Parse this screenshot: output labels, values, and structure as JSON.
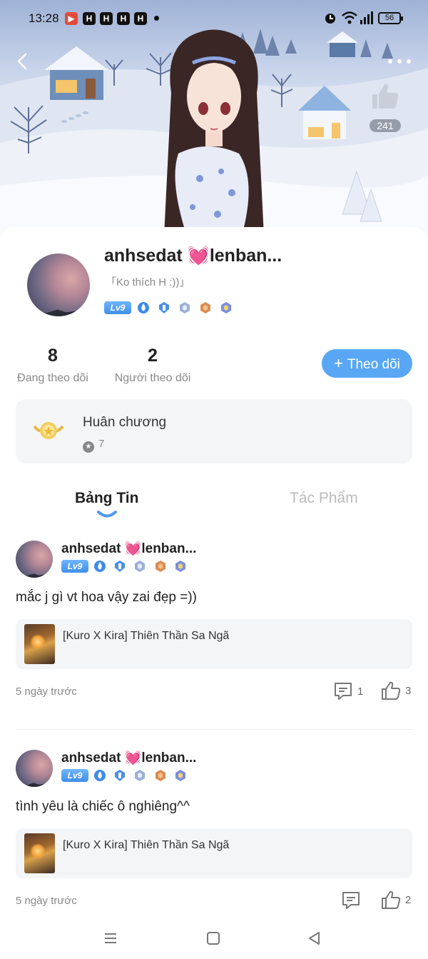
{
  "status_bar": {
    "time": "13:28",
    "battery": "56",
    "app_icons": [
      "game-app-icon",
      "h-app-icon",
      "h-app-icon",
      "h-app-icon",
      "h-app-icon"
    ]
  },
  "hero": {
    "like_count": "241"
  },
  "profile": {
    "username": "anhsedat 💓lenban...",
    "bio": "「Ko thích H :))」",
    "level": "Lv9",
    "stats": [
      {
        "value": "8",
        "label": "Đang theo dõi"
      },
      {
        "value": "2",
        "label": "Người theo dõi"
      }
    ],
    "follow_button": {
      "icon": "+",
      "label": "Theo dõi"
    },
    "medals": {
      "title": "Huân chương",
      "count": "7"
    }
  },
  "tabs": [
    {
      "label": "Bảng Tin",
      "active": true
    },
    {
      "label": "Tác Phẩm",
      "active": false
    }
  ],
  "posts": [
    {
      "author": "anhsedat 💓lenban...",
      "level": "Lv9",
      "text": "mắc j gì vt hoa vậy zai đẹp =))",
      "linked_work": "[Kuro X Kira] Thiên Thần Sa Ngã",
      "time": "5 ngày trước",
      "comments": "1",
      "likes": "3"
    },
    {
      "author": "anhsedat 💓lenban...",
      "level": "Lv9",
      "text": "tình yêu là chiếc ô nghiêng^^",
      "linked_work": "[Kuro X Kira] Thiên Thần Sa Ngã",
      "time": "5 ngày trước",
      "comments": "",
      "likes": "2"
    }
  ],
  "colors": {
    "accent": "#59a7f4",
    "level_badge": "#4a9af0",
    "muted_text": "#888888",
    "panel_bg": "#f4f5f7"
  }
}
